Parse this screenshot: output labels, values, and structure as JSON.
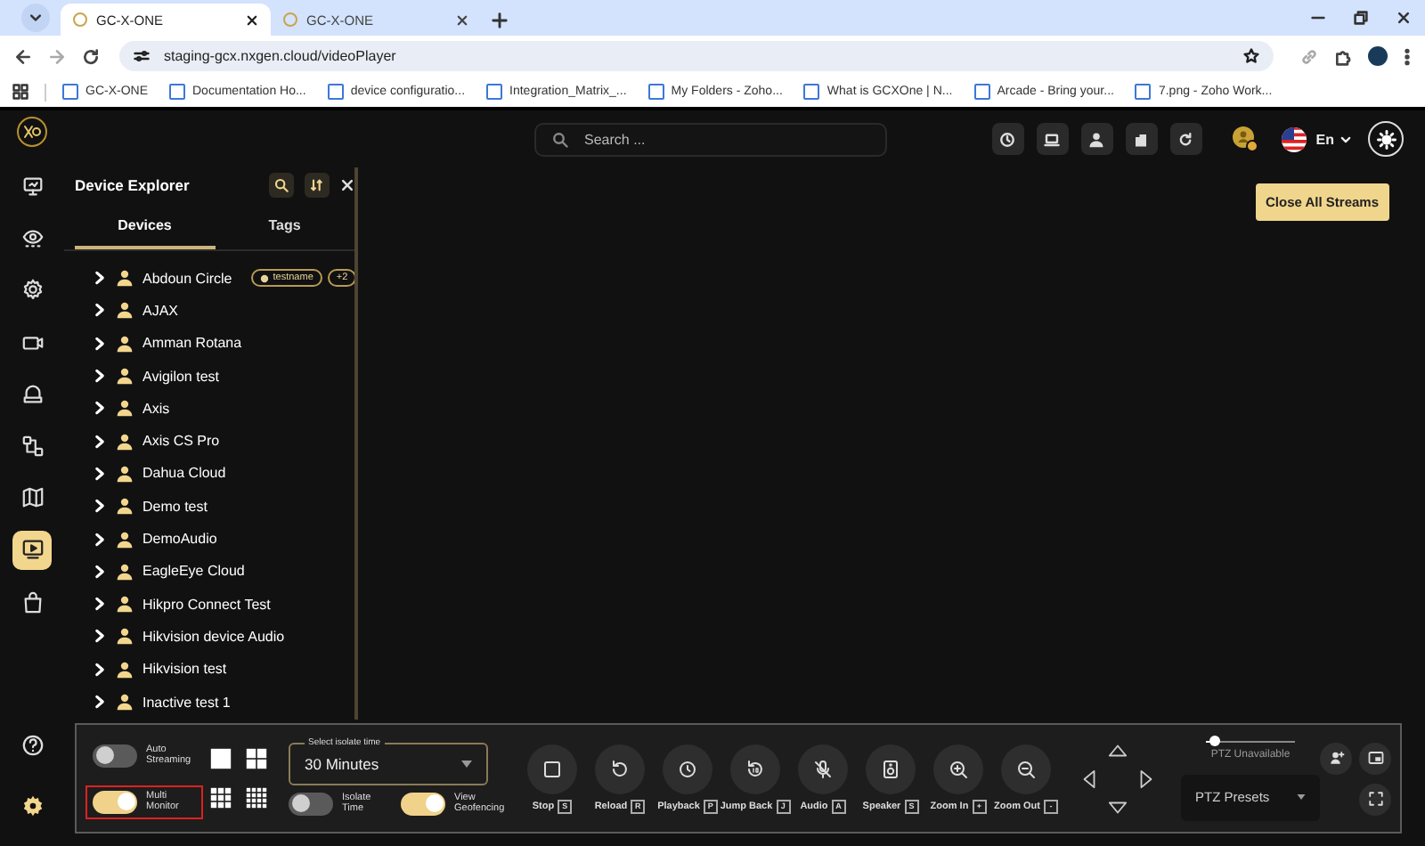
{
  "browser": {
    "tabs": [
      {
        "title": "GC-X-ONE",
        "selected": true
      },
      {
        "title": "GC-X-ONE",
        "selected": false
      }
    ],
    "url": "staging-gcx.nxgen.cloud/videoPlayer",
    "bookmarks": [
      "GC-X-ONE",
      "Documentation Ho...",
      "device configuratio...",
      "Integration_Matrix_...",
      "My Folders - Zoho...",
      "What is GCXOne | N...",
      "Arcade - Bring your...",
      "7.png - Zoho Work..."
    ]
  },
  "nav_rail": {
    "items": [
      {
        "selected": false
      },
      {
        "selected": false
      },
      {
        "selected": false
      },
      {
        "selected": false
      },
      {
        "selected": false
      },
      {
        "selected": false
      },
      {
        "selected": false
      },
      {
        "selected": true
      },
      {
        "selected": false
      }
    ]
  },
  "top_bar": {
    "search": {
      "placeholder": "Search ..."
    },
    "language": "En"
  },
  "device_explorer": {
    "title": "Device Explorer",
    "tabs": [
      {
        "label": "Devices",
        "selected": true
      },
      {
        "label": "Tags",
        "selected": false
      }
    ],
    "devices": [
      {
        "name": "Abdoun Circle",
        "tags": [
          "testname",
          "+2"
        ]
      },
      {
        "name": "AJAX"
      },
      {
        "name": "Amman Rotana"
      },
      {
        "name": "Avigilon test"
      },
      {
        "name": "Axis"
      },
      {
        "name": "Axis CS Pro"
      },
      {
        "name": "Dahua Cloud"
      },
      {
        "name": "Demo test"
      },
      {
        "name": "DemoAudio"
      },
      {
        "name": "EagleEye Cloud"
      },
      {
        "name": "Hikpro Connect Test"
      },
      {
        "name": "Hikvision device Audio"
      },
      {
        "name": "Hikvision test"
      },
      {
        "name": "Inactive test 1"
      }
    ]
  },
  "close_all_button": "Close All Streams",
  "controls": {
    "toggles": [
      {
        "label": "Auto Streaming",
        "on": false
      },
      {
        "label": "Multi Monitor",
        "on": true,
        "highlighted": true
      },
      {
        "label": "Isolate Time",
        "on": false
      },
      {
        "label": "View Geofencing",
        "on": true
      }
    ],
    "isolate_select": {
      "label": "Select isolate time",
      "value": "30 Minutes"
    },
    "actions": [
      {
        "label": "Stop",
        "key": "S"
      },
      {
        "label": "Reload",
        "key": "R"
      },
      {
        "label": "Playback",
        "key": "P"
      },
      {
        "label": "Jump Back",
        "key": "J"
      },
      {
        "label": "Audio",
        "key": "A"
      },
      {
        "label": "Speaker",
        "key": "S"
      },
      {
        "label": "Zoom In",
        "key": "+"
      },
      {
        "label": "Zoom Out",
        "key": "-"
      }
    ],
    "ptz": {
      "level": 0.1,
      "status": "PTZ Unavailable",
      "preset_placeholder": "PTZ Presets"
    }
  }
}
